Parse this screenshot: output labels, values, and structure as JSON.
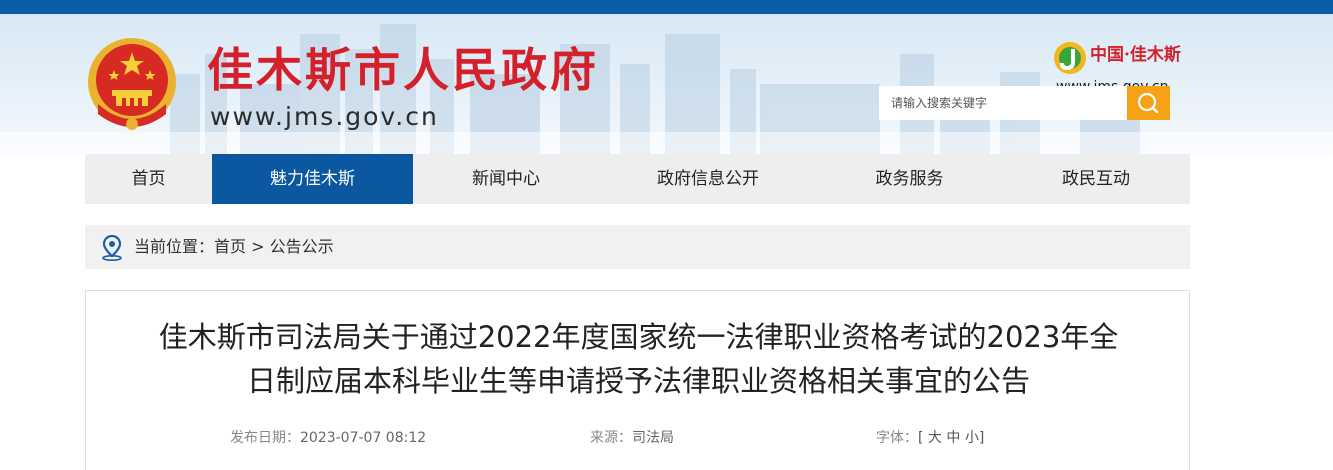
{
  "header": {
    "site_title": "佳木斯市人民政府",
    "site_url": "www.jms.gov.cn",
    "brand_name": "中国·佳木斯",
    "brand_url": "www.jms.gov.cn",
    "accent_color": "#d4202a",
    "topbar_color": "#0a5ea8"
  },
  "search": {
    "placeholder": "请输入搜索关键字",
    "button_color": "#f6a215",
    "icon": "search-icon"
  },
  "nav": {
    "active_color": "#0b57a0",
    "items": [
      {
        "label": "首页"
      },
      {
        "label": "魅力佳木斯",
        "active": true
      },
      {
        "label": "新闻中心"
      },
      {
        "label": "政府信息公开"
      },
      {
        "label": "政务服务"
      },
      {
        "label": "政民互动"
      }
    ]
  },
  "breadcrumb": {
    "prefix": "当前位置：",
    "home": "首页",
    "separator": " > ",
    "current": "公告公示",
    "icon": "location-pin-icon"
  },
  "article": {
    "title_line1": "佳木斯市司法局关于通过2022年度国家统一法律职业资格考试的2023年全",
    "title_line2": "日制应届本科毕业生等申请授予法律职业资格相关事宜的公告",
    "date_label": "发布日期：",
    "date_value": "2023-07-07 08:12",
    "source_label": "来源：",
    "source_value": "司法局",
    "font_label": "字体：",
    "font_open": "[",
    "font_large": "大",
    "font_medium": "中",
    "font_small": "小",
    "font_close": "]"
  }
}
